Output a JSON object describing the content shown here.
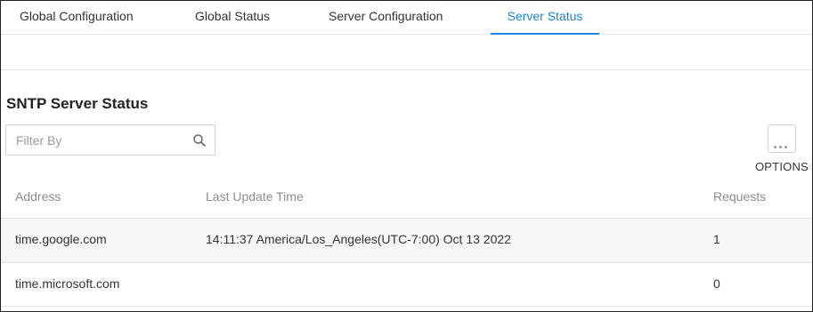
{
  "tabs": [
    {
      "label": "Global Configuration",
      "active": false
    },
    {
      "label": "Global Status",
      "active": false
    },
    {
      "label": "Server Configuration",
      "active": false
    },
    {
      "label": "Server Status",
      "active": true
    }
  ],
  "section": {
    "title": "SNTP Server Status"
  },
  "filter": {
    "placeholder": "Filter By",
    "icon": "search-icon"
  },
  "options": {
    "label": "OPTIONS",
    "icon": "more-horizontal-icon"
  },
  "table": {
    "columns": [
      "Address",
      "Last Update Time",
      "Requests"
    ],
    "rows": [
      {
        "address": "time.google.com",
        "last_update": "14:11:37 America/Los_Angeles(UTC-7:00) Oct 13 2022",
        "requests": "1"
      },
      {
        "address": "time.microsoft.com",
        "last_update": "",
        "requests": "0"
      }
    ]
  },
  "colors": {
    "accent": "#1b87d6",
    "header_text": "#8c8c8c",
    "row_highlight": "#f6f6f6"
  }
}
